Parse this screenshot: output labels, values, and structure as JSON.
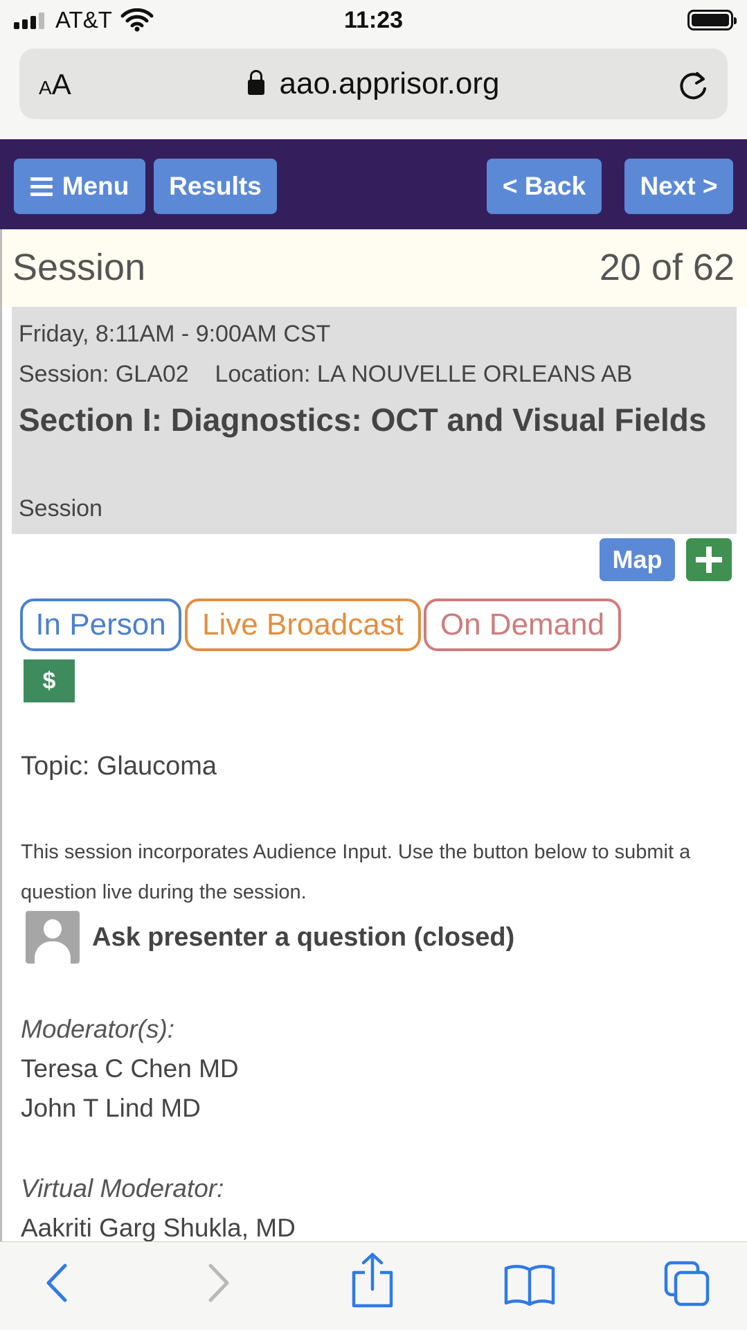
{
  "status_bar": {
    "carrier": "AT&T",
    "time": "11:23",
    "signal_icon": "signal-bars-icon",
    "wifi_icon": "wifi-icon",
    "battery_icon": "battery-icon"
  },
  "browser": {
    "text_size_small": "A",
    "text_size_large": "A",
    "url": "aao.apprisor.org",
    "lock_icon": "lock-icon",
    "reload_icon": "reload-icon"
  },
  "nav": {
    "menu_label": "Menu",
    "results_label": "Results",
    "back_label": "< Back",
    "next_label": "Next >"
  },
  "session": {
    "header_title": "Session",
    "counter": "20 of 62",
    "datetime": "Friday,  8:11AM - 9:00AM CST",
    "code_line": "Session: GLA02    Location: LA NOUVELLE ORLEANS AB",
    "title": "Section I: Diagnostics: OCT and Visual Fields",
    "type": "Session",
    "map_label": "Map",
    "formats": [
      "In Person",
      "Live Broadcast",
      "On Demand"
    ],
    "fee_symbol": "$",
    "topic": "Topic: Glaucoma",
    "audience_note": "This session incorporates Audience Input. Use the button below to submit a question live during the session.",
    "ask_label": "Ask presenter a question (closed)",
    "moderators_label": "Moderator(s):",
    "moderators": [
      "Teresa C Chen MD",
      "John T Lind MD"
    ],
    "virtual_moderator_label": "Virtual Moderator:",
    "virtual_moderator": "Aakriti Garg Shukla, MD"
  },
  "colors": {
    "nav_bg": "#341f5c",
    "button_blue": "#5b89d6",
    "add_green": "#3f9051",
    "in_person": "#4c80cd",
    "live_broadcast": "#e28e3f",
    "on_demand": "#cf7b7b",
    "ios_blue": "#2f7ae5"
  },
  "toolbar": {
    "icons": [
      "back-arrow-icon",
      "forward-arrow-icon",
      "share-icon",
      "bookmarks-icon",
      "tabs-icon"
    ]
  }
}
